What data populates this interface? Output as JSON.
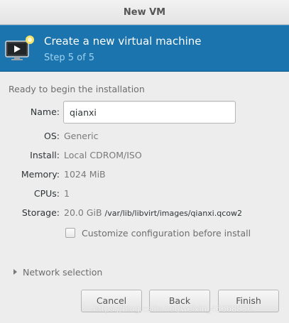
{
  "window": {
    "title": "New VM"
  },
  "banner": {
    "title": "Create a new virtual machine",
    "step": "Step 5 of 5"
  },
  "section": {
    "label": "Ready to begin the installation"
  },
  "fields": {
    "name": {
      "label": "Name:",
      "value": "qianxi"
    },
    "os": {
      "label": "OS:",
      "value": "Generic"
    },
    "install": {
      "label": "Install:",
      "value": "Local CDROM/ISO"
    },
    "memory": {
      "label": "Memory:",
      "value": "1024 MiB"
    },
    "cpus": {
      "label": "CPUs:",
      "value": "1"
    },
    "storage": {
      "label": "Storage:",
      "size": "20.0 GiB",
      "path": "/var/lib/libvirt/images/qianxi.qcow2"
    }
  },
  "customize": {
    "label": "Customize configuration before install",
    "checked": false
  },
  "network": {
    "label": "Network selection",
    "expanded": false
  },
  "buttons": {
    "cancel": "Cancel",
    "back": "Back",
    "finish": "Finish"
  },
  "watermark": "https://blog.csdn.net/weixin_45668836",
  "colors": {
    "banner": "#1b74ad",
    "step_text": "#9fd3f0",
    "background": "#ededed"
  },
  "icons": {
    "banner": "monitor-play-icon",
    "expander": "triangle-right-icon"
  }
}
